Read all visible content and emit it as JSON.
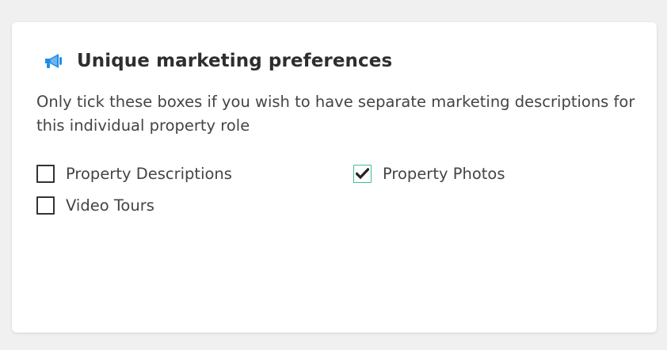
{
  "section": {
    "icon": "megaphone-icon",
    "title": "Unique marketing preferences",
    "description": "Only tick these boxes if you wish to have separate marketing descriptions for this individual property role"
  },
  "options": [
    {
      "label": "Property Descriptions",
      "checked": false
    },
    {
      "label": "Property Photos",
      "checked": true
    },
    {
      "label": "Video Tours",
      "checked": false
    }
  ],
  "colors": {
    "icon": "#1e8ee8",
    "checked_border": "#3dbf8e",
    "checkmark": "#222222"
  }
}
